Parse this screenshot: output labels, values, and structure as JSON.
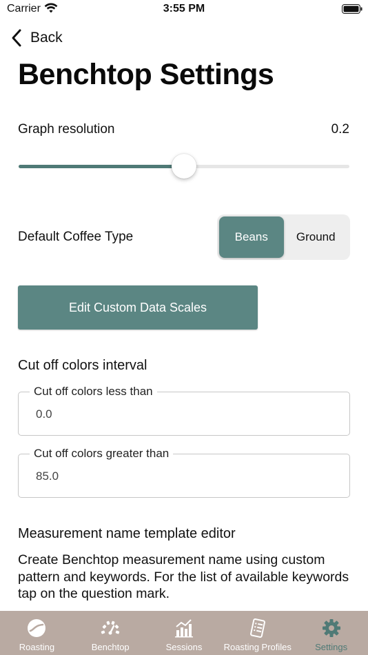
{
  "status_bar": {
    "carrier": "Carrier",
    "time": "3:55 PM"
  },
  "nav": {
    "back_label": "Back"
  },
  "page_title": "Benchtop Settings",
  "graph_resolution": {
    "label": "Graph resolution",
    "value": "0.2",
    "slider_fraction": 0.5
  },
  "coffee_type": {
    "label": "Default Coffee Type",
    "options": [
      "Beans",
      "Ground"
    ],
    "selected": "Beans"
  },
  "edit_scales_button": "Edit Custom Data Scales",
  "cutoff": {
    "title": "Cut off colors interval",
    "less_than": {
      "label": "Cut off colors less than",
      "value": "0.0"
    },
    "greater_than": {
      "label": "Cut off colors greater than",
      "value": "85.0"
    }
  },
  "template_editor": {
    "title": "Measurement name template editor",
    "description": "Create Benchtop measurement name using custom pattern and keywords. For the list of available keywords tap on the question mark."
  },
  "tabbar": {
    "tabs": [
      {
        "label": "Roasting",
        "icon": "coffee-bean-icon"
      },
      {
        "label": "Benchtop",
        "icon": "gauge-icon"
      },
      {
        "label": "Sessions",
        "icon": "bar-chart-icon"
      },
      {
        "label": "Roasting Profiles",
        "icon": "document-list-icon"
      },
      {
        "label": "Settings",
        "icon": "gear-icon"
      }
    ],
    "active": "Settings"
  },
  "colors": {
    "accent": "#5b8683",
    "tabbar_bg": "#b9aaa2",
    "tab_active": "#4f7a76"
  }
}
